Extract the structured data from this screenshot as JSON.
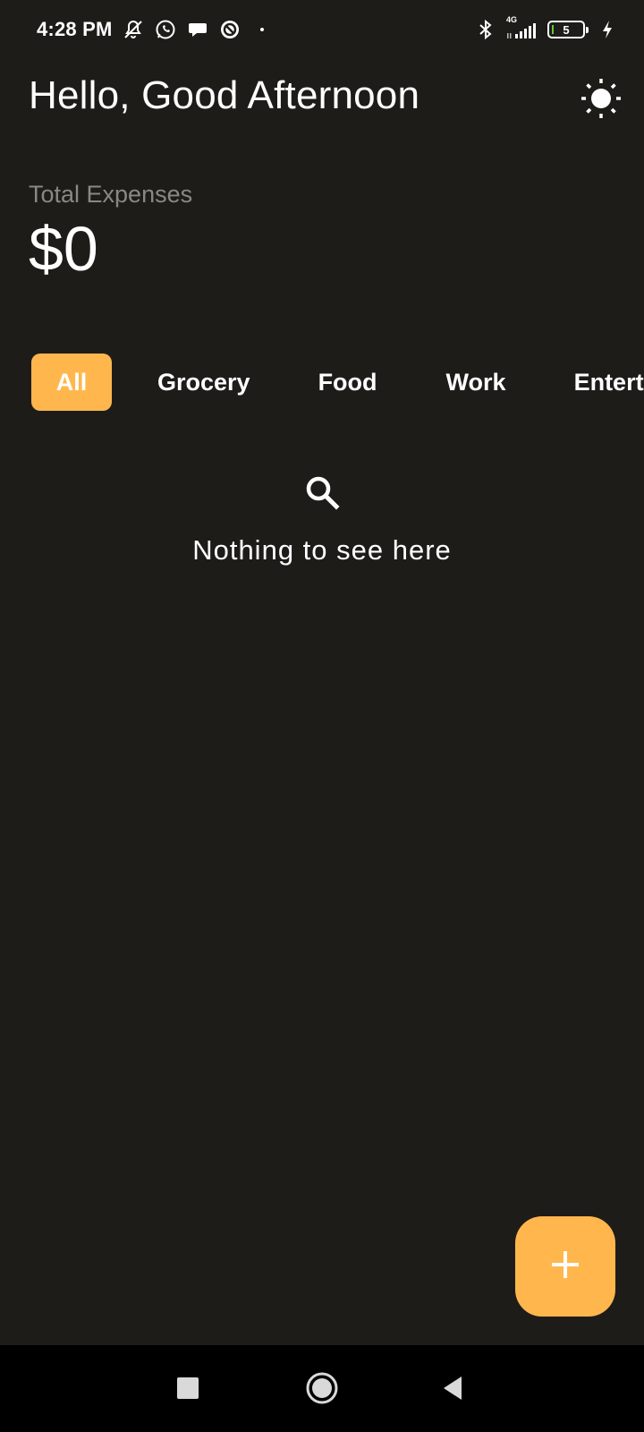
{
  "status_bar": {
    "time": "4:28 PM",
    "network": "4G",
    "battery_level": "5",
    "icons_left": [
      "mute-bell-icon",
      "whatsapp-icon",
      "chat-bubble-icon",
      "vpn-icon",
      "dot-icon"
    ],
    "icons_right": [
      "bluetooth-icon",
      "signal-icon",
      "battery-icon",
      "charging-icon"
    ]
  },
  "header": {
    "greeting": "Hello, Good Afternoon",
    "theme_icon": "sun-icon"
  },
  "summary": {
    "label": "Total Expenses",
    "value": "$0"
  },
  "categories": {
    "items": [
      {
        "label": "All",
        "active": true
      },
      {
        "label": "Grocery",
        "active": false
      },
      {
        "label": "Food",
        "active": false
      },
      {
        "label": "Work",
        "active": false
      },
      {
        "label": "Entertainment",
        "active": false
      }
    ]
  },
  "empty_state": {
    "icon": "search-icon",
    "message": "Nothing to see here"
  },
  "fab": {
    "icon": "plus-icon"
  },
  "nav": {
    "icons": [
      "recents-square-icon",
      "home-circle-icon",
      "back-triangle-icon"
    ]
  },
  "colors": {
    "background": "#1e1c19",
    "accent": "#ffb74d",
    "muted_text": "#8a8884",
    "nav_background": "#000000"
  }
}
